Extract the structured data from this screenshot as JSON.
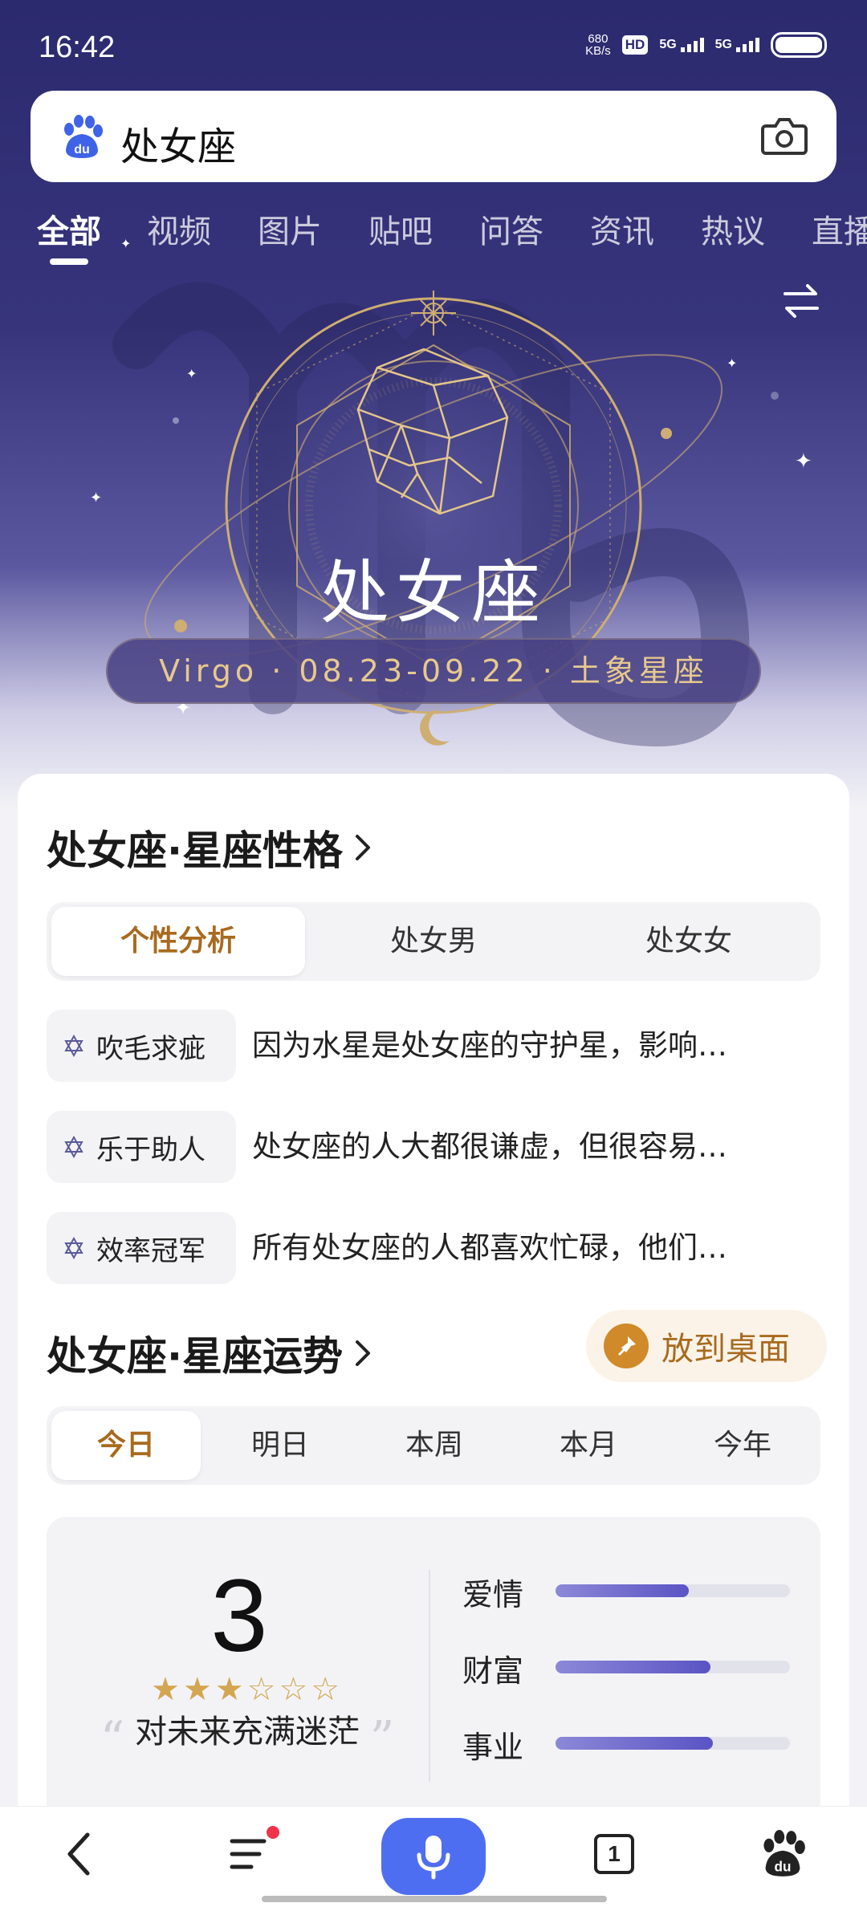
{
  "status_bar": {
    "time": "16:42",
    "net_speed_value": "680",
    "net_speed_unit": "KB/s",
    "hd_label": "HD",
    "signal1_label": "5G",
    "signal2_label": "5G"
  },
  "search": {
    "query": "处女座",
    "logo_icon": "baidu-paw-icon",
    "camera_icon": "camera-icon"
  },
  "tabs": [
    {
      "label": "全部",
      "active": true
    },
    {
      "label": "视频"
    },
    {
      "label": "图片"
    },
    {
      "label": "贴吧"
    },
    {
      "label": "问答"
    },
    {
      "label": "资讯"
    },
    {
      "label": "热议"
    },
    {
      "label": "直播"
    }
  ],
  "hero": {
    "title": "处女座",
    "subtitle": "Virgo · 08.23-09.22 · 土象星座"
  },
  "personality": {
    "title": "处女座·星座性格",
    "segments": [
      "个性分析",
      "处女男",
      "处女女"
    ],
    "active_segment": 0,
    "traits": [
      {
        "tag": "吹毛求疵",
        "desc": "因为水星是处女座的守护星，影响…"
      },
      {
        "tag": "乐于助人",
        "desc": "处女座的人大都很谦虚，但很容易…"
      },
      {
        "tag": "效率冠军",
        "desc": "所有处女座的人都喜欢忙碌，他们…"
      }
    ]
  },
  "fortune": {
    "title": "处女座·星座运势",
    "pin_label": "放到桌面",
    "segments": [
      "今日",
      "明日",
      "本周",
      "本月",
      "今年"
    ],
    "active_segment": 0,
    "score": "3",
    "stars_filled": 3,
    "stars_total": 6,
    "quote": "对未来充满迷茫",
    "bars": [
      {
        "label": "爱情",
        "level": 0.57
      },
      {
        "label": "财富",
        "level": 0.66
      },
      {
        "label": "事业",
        "level": 0.67
      }
    ]
  },
  "bottom_nav": {
    "tab_count": "1"
  },
  "colors": {
    "hero_dark": "#2c2a6e",
    "gold": "#e7c98d",
    "accent_brown": "#a86a1e",
    "baidu_blue": "#4e6ef2"
  }
}
